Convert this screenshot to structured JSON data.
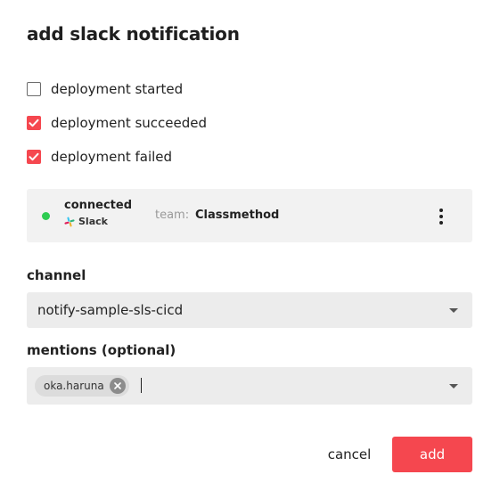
{
  "dialog": {
    "title": "add slack notification"
  },
  "events": [
    {
      "label": "deployment started",
      "checked": false
    },
    {
      "label": "deployment succeeded",
      "checked": true
    },
    {
      "label": "deployment failed",
      "checked": true
    }
  ],
  "integration": {
    "status": "connected",
    "status_color": "#2ecc52",
    "service": "Slack",
    "service_icon": "slack-icon",
    "team_key": "team:",
    "team_value": "Classmethod",
    "menu_icon": "kebab-menu-icon"
  },
  "channel": {
    "label": "channel",
    "value": "notify-sample-sls-cicd"
  },
  "mentions": {
    "label": "mentions (optional)",
    "chips": [
      {
        "label": "oka.haruna"
      }
    ]
  },
  "actions": {
    "cancel_label": "cancel",
    "add_label": "add"
  },
  "colors": {
    "accent": "#f5474f",
    "field_bg": "#ececec",
    "card_bg": "#f2f2f2"
  }
}
